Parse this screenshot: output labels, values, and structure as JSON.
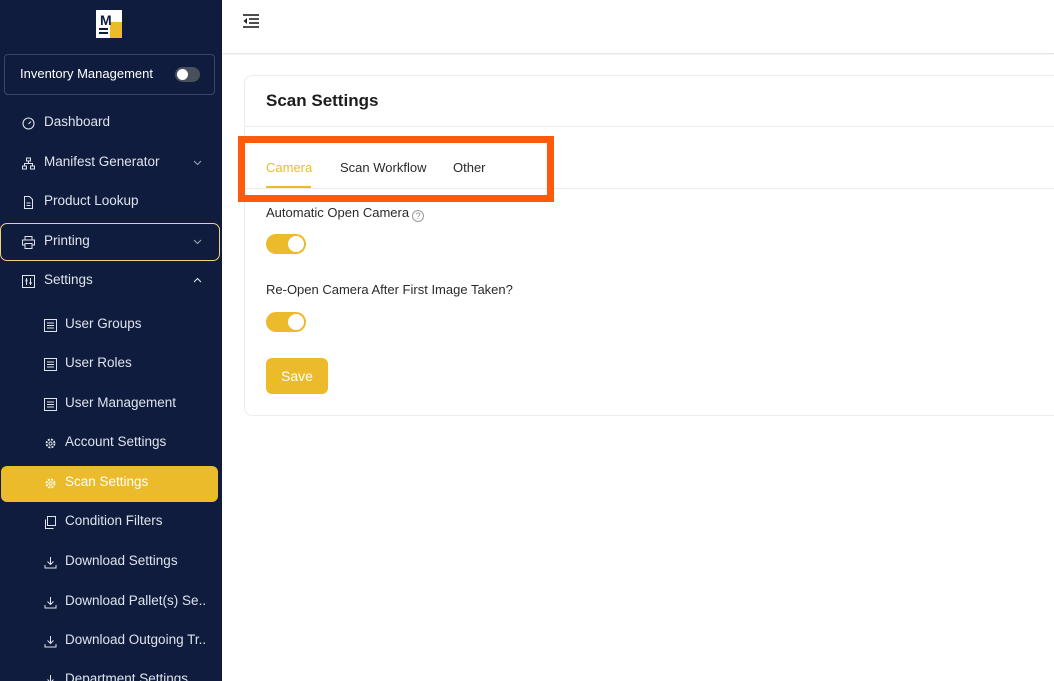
{
  "sidebar": {
    "logo_text": "M",
    "inventory_label": "Inventory Management",
    "items": [
      {
        "label": "Dashboard",
        "icon": "dashboard-icon"
      },
      {
        "label": "Manifest Generator",
        "icon": "sitemap-icon"
      },
      {
        "label": "Product Lookup",
        "icon": "document-icon"
      },
      {
        "label": "Printing",
        "icon": "printer-icon"
      },
      {
        "label": "Settings",
        "icon": "settings-panel-icon"
      }
    ],
    "sub_items": [
      {
        "label": "User Groups",
        "icon": "list-icon"
      },
      {
        "label": "User Roles",
        "icon": "list-icon"
      },
      {
        "label": "User Management",
        "icon": "list-icon"
      },
      {
        "label": "Account Settings",
        "icon": "gear-icon"
      },
      {
        "label": "Scan Settings",
        "icon": "gear-icon"
      },
      {
        "label": "Condition Filters",
        "icon": "copy-icon"
      },
      {
        "label": "Download Settings",
        "icon": "download-icon"
      },
      {
        "label": "Download Pallet(s) Se...",
        "icon": "download-icon"
      },
      {
        "label": "Download Outgoing Tr...",
        "icon": "download-icon"
      },
      {
        "label": "Department Settings",
        "icon": "download-icon"
      }
    ]
  },
  "page": {
    "title": "Scan Settings",
    "tabs": [
      "Camera",
      "Scan Workflow",
      "Other"
    ],
    "fields": [
      {
        "label": "Automatic Open Camera",
        "enabled": true
      },
      {
        "label": "Re-Open Camera After First Image Taken?",
        "enabled": true
      }
    ],
    "save_label": "Save",
    "help_glyph": "?"
  },
  "colors": {
    "sidebar_bg": "#101c3d",
    "accent": "#ecbb2c",
    "highlight": "#ff5a0a"
  }
}
